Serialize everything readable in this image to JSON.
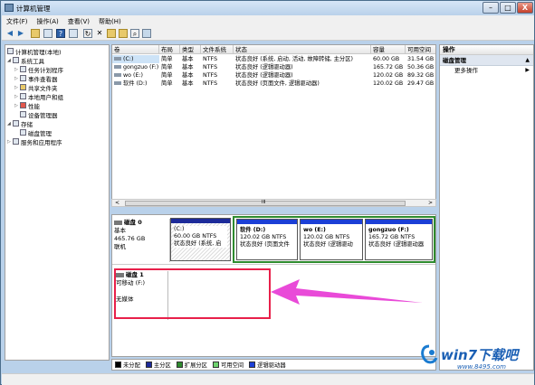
{
  "window": {
    "title": "计算机管理",
    "min": "–",
    "max": "□",
    "close": "X"
  },
  "menu": [
    "文件(F)",
    "操作(A)",
    "查看(V)",
    "帮助(H)"
  ],
  "tree": [
    {
      "label": "计算机管理(本地)",
      "level": 0
    },
    {
      "label": "系统工具",
      "level": 1
    },
    {
      "label": "任务计划程序",
      "level": 2
    },
    {
      "label": "事件查看器",
      "level": 2
    },
    {
      "label": "共享文件夹",
      "level": 2
    },
    {
      "label": "本地用户和组",
      "level": 2
    },
    {
      "label": "性能",
      "level": 2
    },
    {
      "label": "设备管理器",
      "level": 2
    },
    {
      "label": "存储",
      "level": 1
    },
    {
      "label": "磁盘管理",
      "level": 2
    },
    {
      "label": "服务和应用程序",
      "level": 1
    }
  ],
  "volumes": {
    "headers": [
      "卷",
      "布局",
      "类型",
      "文件系统",
      "状态",
      "容量",
      "可用空间"
    ],
    "rows": [
      [
        "(C:)",
        "简单",
        "基本",
        "NTFS",
        "状态良好 (系统, 启动, 活动, 故障转储, 主分区)",
        "60.00 GB",
        "31.54 GB"
      ],
      [
        "gongzuo (F:)",
        "简单",
        "基本",
        "NTFS",
        "状态良好 (逻辑驱动器)",
        "165.72 GB",
        "50.36 GB"
      ],
      [
        "wo (E:)",
        "简单",
        "基本",
        "NTFS",
        "状态良好 (逻辑驱动器)",
        "120.02 GB",
        "89.32 GB"
      ],
      [
        "软件 (D:)",
        "简单",
        "基本",
        "NTFS",
        "状态良好 (页面文件, 逻辑驱动器)",
        "120.02 GB",
        "29.47 GB"
      ]
    ]
  },
  "scroll": {
    "left": "<",
    "grip": "III",
    "right": ">"
  },
  "disk0": {
    "name": "磁盘 0",
    "type": "基本",
    "size": "465.76 GB",
    "status": "联机",
    "partitions": [
      {
        "name": "(C:)",
        "size": "60.00 GB NTFS",
        "status": "状态良好 (系统, 启"
      },
      {
        "name": "软件 (D:)",
        "size": "120.02 GB NTFS",
        "status": "状态良好 (页面文件"
      },
      {
        "name": "wo (E:)",
        "size": "120.02 GB NTFS",
        "status": "状态良好 (逻辑驱动"
      },
      {
        "name": "gongzuo (F:)",
        "size": "165.72 GB NTFS",
        "status": "状态良好 (逻辑驱动器"
      }
    ]
  },
  "disk1": {
    "name": "磁盘 1",
    "type": "可移动 (F:)",
    "status": "无媒体"
  },
  "legend": [
    {
      "label": "未分配",
      "color": "#000000"
    },
    {
      "label": "主分区",
      "color": "#1d2b9a"
    },
    {
      "label": "扩展分区",
      "color": "#2e8b2e"
    },
    {
      "label": "可用空间",
      "color": "#6fd36f"
    },
    {
      "label": "逻辑驱动器",
      "color": "#1b3fd6"
    }
  ],
  "actions": {
    "header": "操作",
    "section": "磁盘管理",
    "more": "更多操作"
  },
  "watermark": {
    "brand": "win7下载吧",
    "url": "www.8495.com"
  }
}
